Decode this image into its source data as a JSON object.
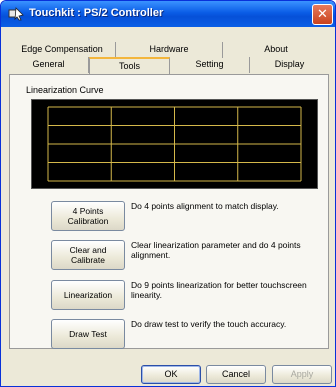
{
  "window": {
    "title": "Touchkit : PS/2 Controller",
    "close_glyph": "✕"
  },
  "tabs": {
    "top": [
      "Edge Compensation",
      "Hardware",
      "About"
    ],
    "bottom": [
      "General",
      "Tools",
      "Setting",
      "Display"
    ],
    "active": "Tools"
  },
  "linearization": {
    "label": "Linearization Curve",
    "grid_color": "#d4b84a",
    "background_color": "#000000"
  },
  "actions": [
    {
      "button": "4 Points\nCalibration",
      "description": "Do 4 points alignment to match display."
    },
    {
      "button": "Clear and\nCalibrate",
      "description": "Clear linearization parameter and do 4 points alignment."
    },
    {
      "button": "Linearization",
      "description": "Do 9 points linearization for better touchscreen linearity."
    },
    {
      "button": "Draw Test",
      "description": "Do draw test to verify the touch accuracy."
    }
  ],
  "footer": {
    "ok": "OK",
    "cancel": "Cancel",
    "apply": "Apply"
  }
}
